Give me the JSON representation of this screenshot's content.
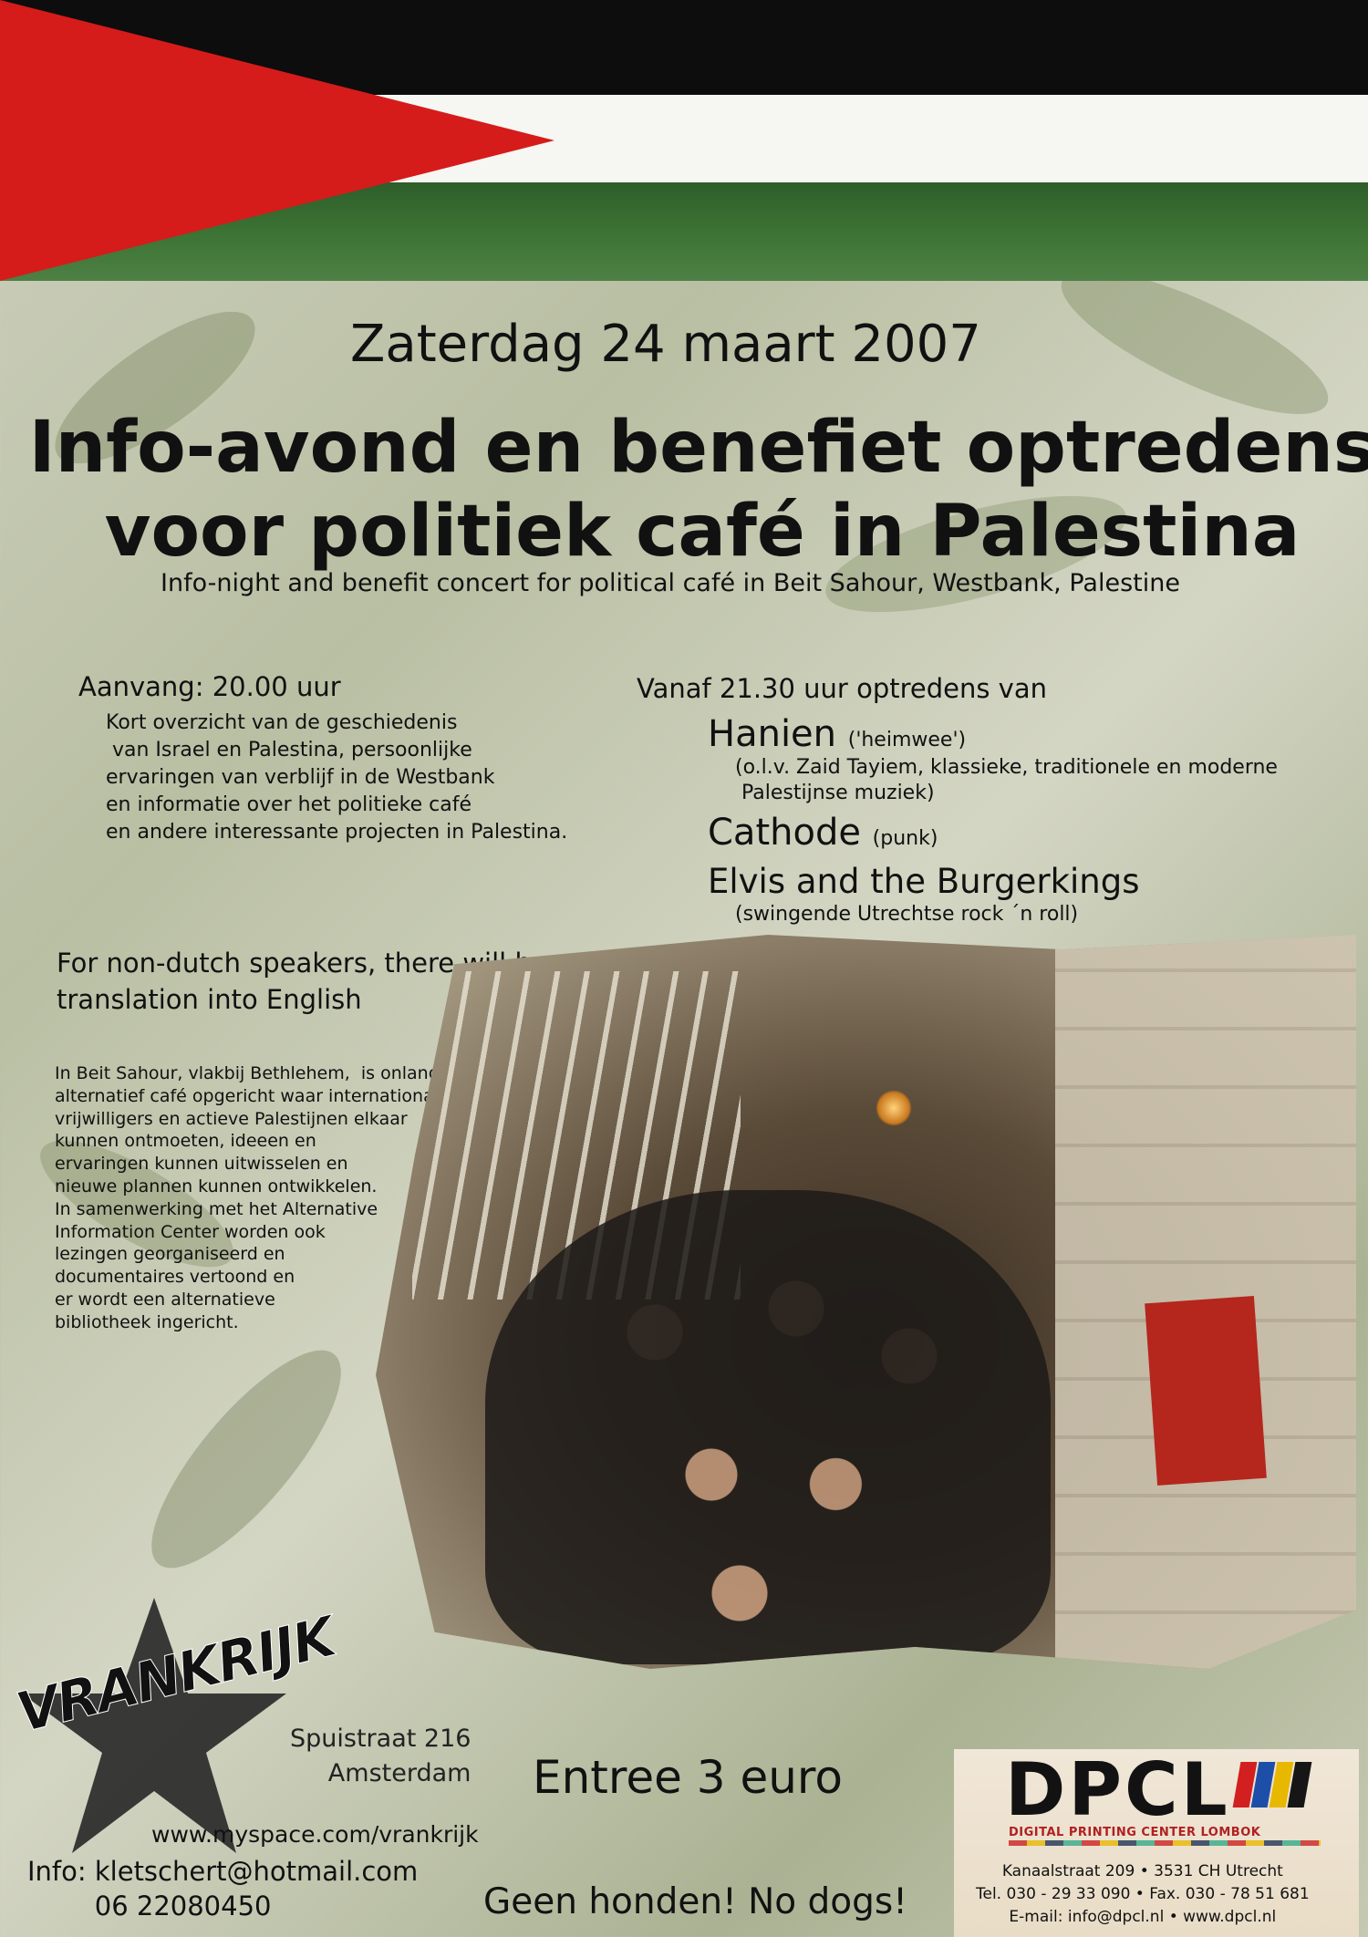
{
  "flag": {
    "colors": {
      "black": "#0d0d0d",
      "white": "#f6f6f2",
      "green": "#3f7636",
      "red": "#d51c1a"
    }
  },
  "header": {
    "date": "Zaterdag 24 maart 2007",
    "title_line1": "Info-avond en benefiet optredens",
    "title_line2": "voor politiek café in Palestina",
    "subtitle": "Info-night and benefit concert for political café in Beit Sahour, Westbank, Palestine"
  },
  "program": {
    "start_label": "Aanvang: 20.00 uur",
    "start_body": "Kort overzicht van de geschiedenis\n van Israel en Palestina, persoonlijke\nervaringen van verblijf in de Westbank\nen informatie over het politieke café\nen andere interessante projecten in Palestina.",
    "acts_label": "Vanaf 21.30 uur optredens van",
    "acts": [
      {
        "name": "Hanien",
        "note": "('heimwee')",
        "desc": "(o.l.v. Zaid Tayiem, klassieke, traditionele en moderne\n Palestijnse muziek)"
      },
      {
        "name": "Cathode",
        "note": "(punk)",
        "desc": ""
      },
      {
        "name": "Elvis and the Burgerkings",
        "note": "",
        "desc": "(swingende Utrechtse rock ´n roll)"
      }
    ],
    "translation": "For non-dutch speakers, there will be\ntranslation into English",
    "story": "In Beit Sahour, vlakbij Bethlehem,  is onlangs een\nalternatief café opgericht waar internationale\nvrijwilligers en actieve Palestijnen elkaar\nkunnen ontmoeten, ideeen en\nervaringen kunnen uitwisselen en\nnieuwe plannen kunnen ontwikkelen.\nIn samenwerking met het Alternative\nInformation Center worden ook\nlezingen georganiseerd en\ndocumentaires vertoond en\ner wordt een alternatieve\nbibliotheek ingericht."
  },
  "venue": {
    "logo": "VRANKRIJK",
    "address": "Spuistraat 216\nAmsterdam",
    "website": "www.myspace.com/vrankrijk",
    "info": "Info: kletschert@hotmail.com\n        06 22080450"
  },
  "entry": {
    "price": "Entree 3 euro",
    "dogs": "Geen honden! No dogs!"
  },
  "printer": {
    "logo": "DPCL",
    "name": "DIGITAL PRINTING CENTER LOMBOK",
    "lines": "Kanaalstraat 209 • 3531 CH Utrecht\nTel. 030 - 29 33 090 • Fax. 030 - 78 51 681\nE-mail: info@dpcl.nl • www.dpcl.nl",
    "bar_colors": [
      "#d22020",
      "#1e4fa8",
      "#e8b800",
      "#161616"
    ]
  }
}
